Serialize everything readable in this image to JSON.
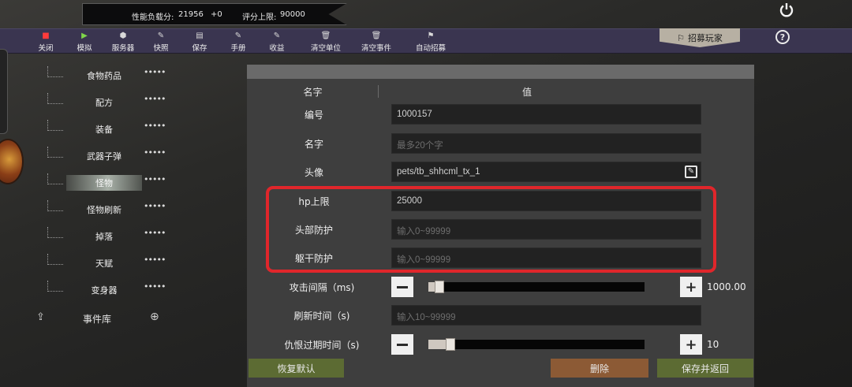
{
  "stats": {
    "load_label": "性能负载分:",
    "load_value": "21956",
    "load_delta": "+0",
    "score_label": "评分上限:",
    "score_value": "90000"
  },
  "toolbar": {
    "items": [
      {
        "label": "关闭",
        "icon": "stop-icon"
      },
      {
        "label": "模拟",
        "icon": "play-icon"
      },
      {
        "label": "服务器",
        "icon": "cube-icon"
      },
      {
        "label": "快照",
        "icon": "note-icon"
      },
      {
        "label": "保存",
        "icon": "page-icon"
      },
      {
        "label": "手册",
        "icon": "note-icon"
      },
      {
        "label": "收益",
        "icon": "note-icon"
      },
      {
        "label": "清空单位",
        "icon": "trash-icon"
      },
      {
        "label": "清空事件",
        "icon": "trash-icon"
      },
      {
        "label": "自动招募",
        "icon": "flag-icon"
      }
    ],
    "recruit_label": "招募玩家",
    "help_label": "?"
  },
  "sidebar": {
    "items": [
      {
        "label": "食物药品",
        "active": false
      },
      {
        "label": "配方",
        "active": false
      },
      {
        "label": "装备",
        "active": false
      },
      {
        "label": "武器子弹",
        "active": false
      },
      {
        "label": "怪物",
        "active": true
      },
      {
        "label": "怪物刷新",
        "active": false
      },
      {
        "label": "掉落",
        "active": false
      },
      {
        "label": "天赋",
        "active": false
      },
      {
        "label": "变身器",
        "active": false
      }
    ],
    "dots": "•••••",
    "event_library": "事件库"
  },
  "table": {
    "header_name": "名字",
    "header_value": "值",
    "rows": {
      "id": {
        "label": "编号",
        "value": "1000157",
        "placeholder": ""
      },
      "name": {
        "label": "名字",
        "value": "",
        "placeholder": "最多20个字"
      },
      "avatar": {
        "label": "头像",
        "value": "pets/tb_shhcml_tx_1",
        "placeholder": ""
      },
      "hp": {
        "label": "hp上限",
        "value": "25000",
        "placeholder": ""
      },
      "head_armor": {
        "label": "头部防护",
        "value": "",
        "placeholder": "输入0~99999"
      },
      "body_armor": {
        "label": "躯干防护",
        "value": "",
        "placeholder": "输入0~99999"
      },
      "attack_interval": {
        "label": "攻击间隔（ms)",
        "value": "1000.00",
        "level": 0.03
      },
      "refresh_time": {
        "label": "刷新时间（s)",
        "value": "",
        "placeholder": "输入10~99999"
      },
      "aggro_expire": {
        "label": "仇恨过期时间（s)",
        "value": "10",
        "level": 0.08
      }
    }
  },
  "buttons": {
    "reset": "恢复默认",
    "delete": "删除",
    "save_return": "保存并返回"
  },
  "colors": {
    "toolbar_bg": "#3a3550",
    "highlight": "#e0262b",
    "green_button": "#5c6b33",
    "delete_button": "#8c5a35"
  }
}
